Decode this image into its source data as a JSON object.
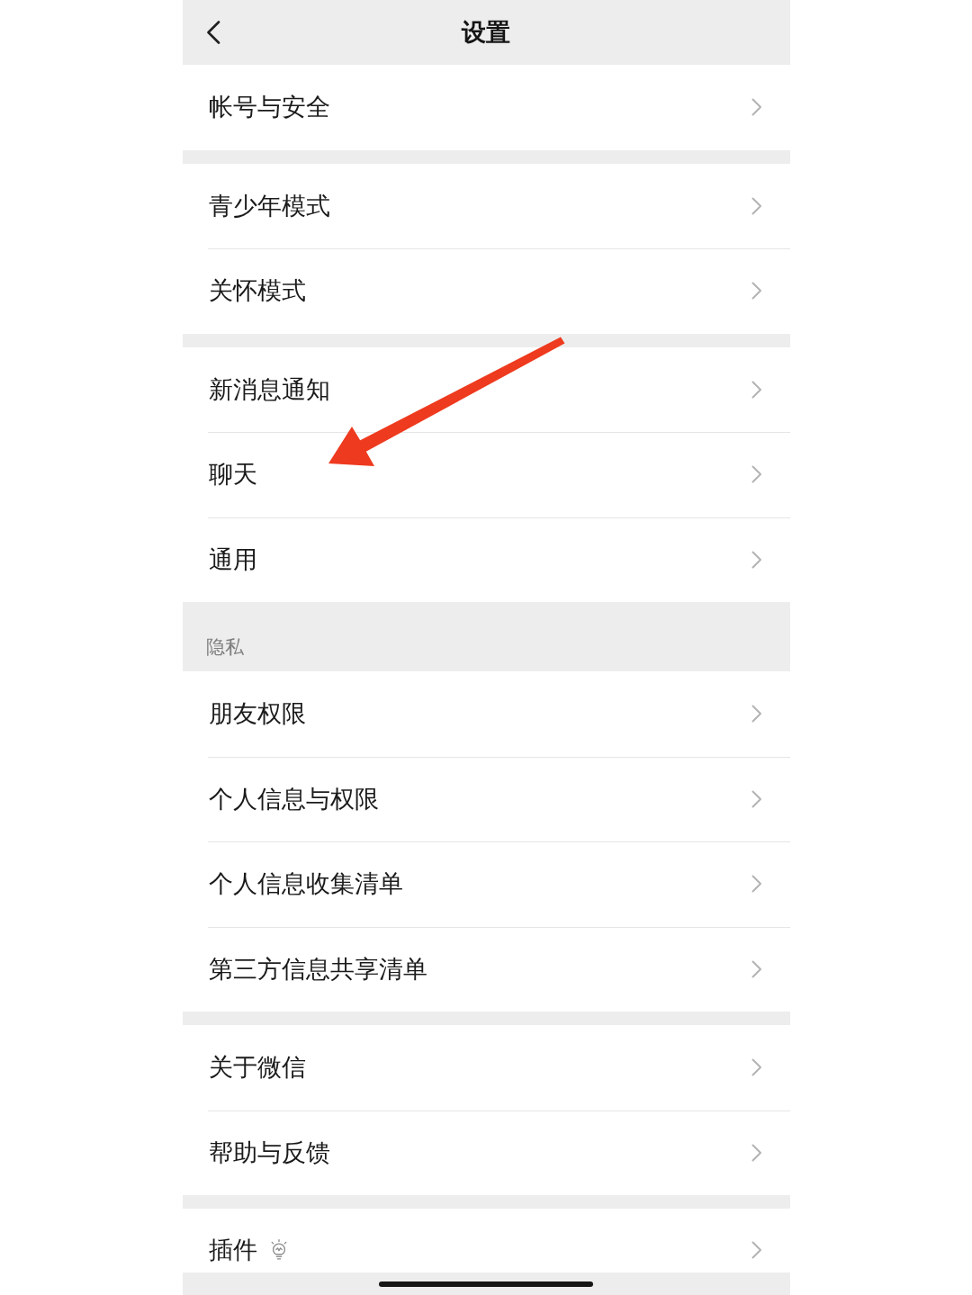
{
  "nav_bar": {
    "title": "设置"
  },
  "groups": [
    {
      "items": [
        {
          "label": "帐号与安全",
          "kind": "plain"
        }
      ]
    },
    {
      "items": [
        {
          "label": "青少年模式",
          "kind": "plain"
        },
        {
          "label": "关怀模式",
          "kind": "plain"
        }
      ]
    },
    {
      "items": [
        {
          "label": "新消息通知",
          "kind": "plain"
        },
        {
          "label": "聊天",
          "kind": "plain"
        },
        {
          "label": "通用",
          "kind": "plain"
        }
      ]
    },
    {
      "title": "隐私",
      "items": [
        {
          "label": "朋友权限",
          "kind": "plain"
        },
        {
          "label": "个人信息与权限",
          "kind": "plain"
        },
        {
          "label": "个人信息收集清单",
          "kind": "plain"
        },
        {
          "label": "第三方信息共享清单",
          "kind": "plain"
        }
      ]
    },
    {
      "items": [
        {
          "label": "关于微信",
          "kind": "plain"
        },
        {
          "label": "帮助与反馈",
          "kind": "plain"
        }
      ]
    },
    {
      "items": [
        {
          "label": "插件",
          "kind": "icon"
        }
      ]
    }
  ]
}
